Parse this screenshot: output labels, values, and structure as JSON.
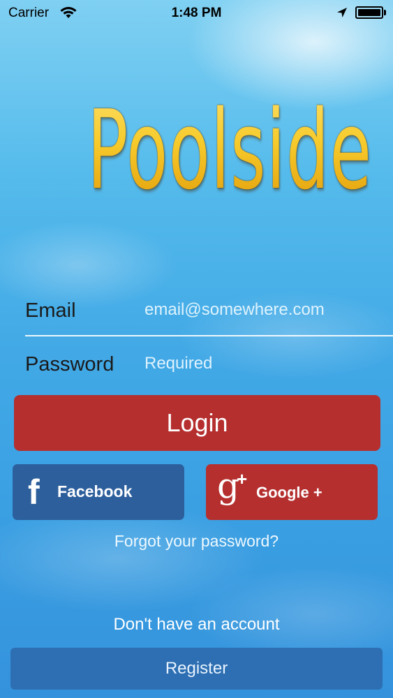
{
  "status_bar": {
    "carrier": "Carrier",
    "time": "1:48 PM",
    "wifi_icon": "wifi-icon",
    "location_icon": "location-arrow-icon",
    "battery_icon": "battery-icon"
  },
  "logo": {
    "text": "Poolside",
    "color": "#f5c21f"
  },
  "form": {
    "email": {
      "label": "Email",
      "placeholder": "email@somewhere.com",
      "value": ""
    },
    "password": {
      "label": "Password",
      "placeholder": "Required",
      "value": ""
    }
  },
  "buttons": {
    "login": "Login",
    "facebook": {
      "icon_glyph": "f",
      "icon": "facebook-icon",
      "label": "Facebook",
      "color": "#2d5f9c"
    },
    "google": {
      "icon_glyph": "g",
      "icon_plus": "+",
      "icon": "google-plus-icon",
      "label": "Google +",
      "color": "#b52f2f"
    },
    "login_color": "#b52f2f"
  },
  "links": {
    "forgot_password": "Forgot your password?"
  },
  "register": {
    "prompt": "Don't have an account",
    "button": "Register",
    "color": "#2d6fb2"
  }
}
